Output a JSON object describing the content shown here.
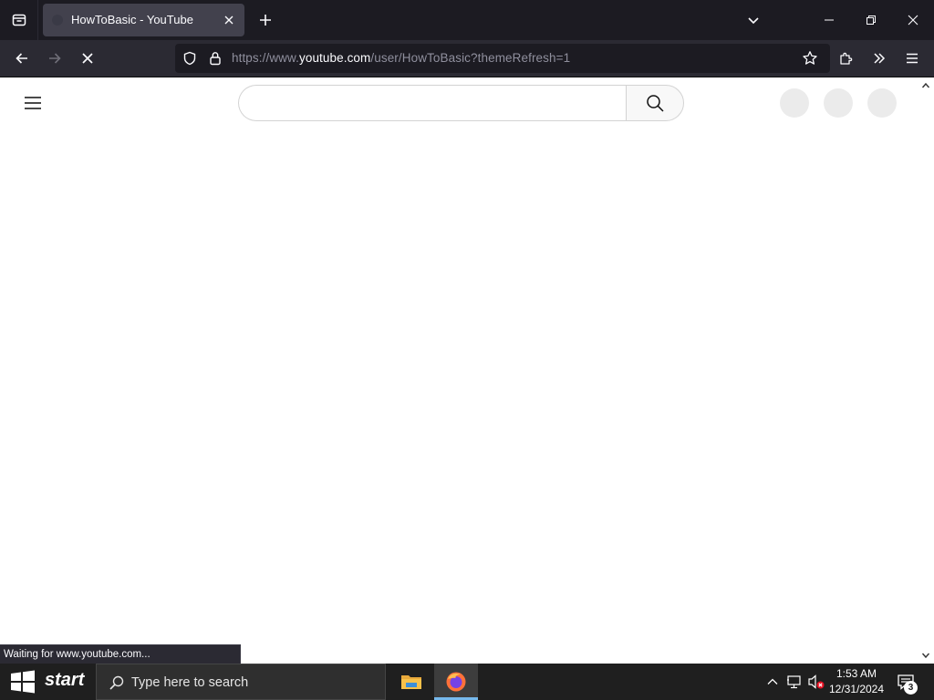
{
  "browser": {
    "tab": {
      "title": "HowToBasic - YouTube"
    },
    "url": {
      "prefix": "https://www.",
      "domain": "youtube.com",
      "path": "/user/HowToBasic?themeRefresh=1"
    },
    "status_text": "Waiting for www.youtube.com..."
  },
  "page": {
    "search": {
      "value": "",
      "placeholder": ""
    }
  },
  "taskbar": {
    "start_label": "start",
    "search_placeholder": "Type here to search",
    "clock_time": "1:53 AM",
    "clock_date": "12/31/2024",
    "notification_count": "3"
  },
  "colors": {
    "tabstrip_bg": "#1c1b22",
    "navbar_bg": "#2b2a33",
    "taskbar_bg": "#1f1f1f",
    "active_app_underline": "#76b9ed"
  },
  "icons": {
    "tabstrip": [
      "list-all-tabs-icon",
      "close-icon",
      "plus-icon",
      "chevron-down-icon",
      "minimize-icon",
      "maximize-icon",
      "close-window-icon"
    ],
    "navbar": [
      "back-arrow-icon",
      "forward-arrow-icon",
      "stop-icon",
      "shield-icon",
      "lock-icon",
      "star-icon",
      "extensions-icon",
      "overflow-icon",
      "hamburger-menu-icon"
    ],
    "page": [
      "hamburger-icon",
      "search-icon"
    ],
    "taskbar": [
      "windows-logo-icon",
      "search-icon",
      "file-explorer-icon",
      "firefox-icon",
      "chevron-up-icon",
      "network-icon",
      "volume-muted-icon",
      "notification-icon"
    ]
  }
}
